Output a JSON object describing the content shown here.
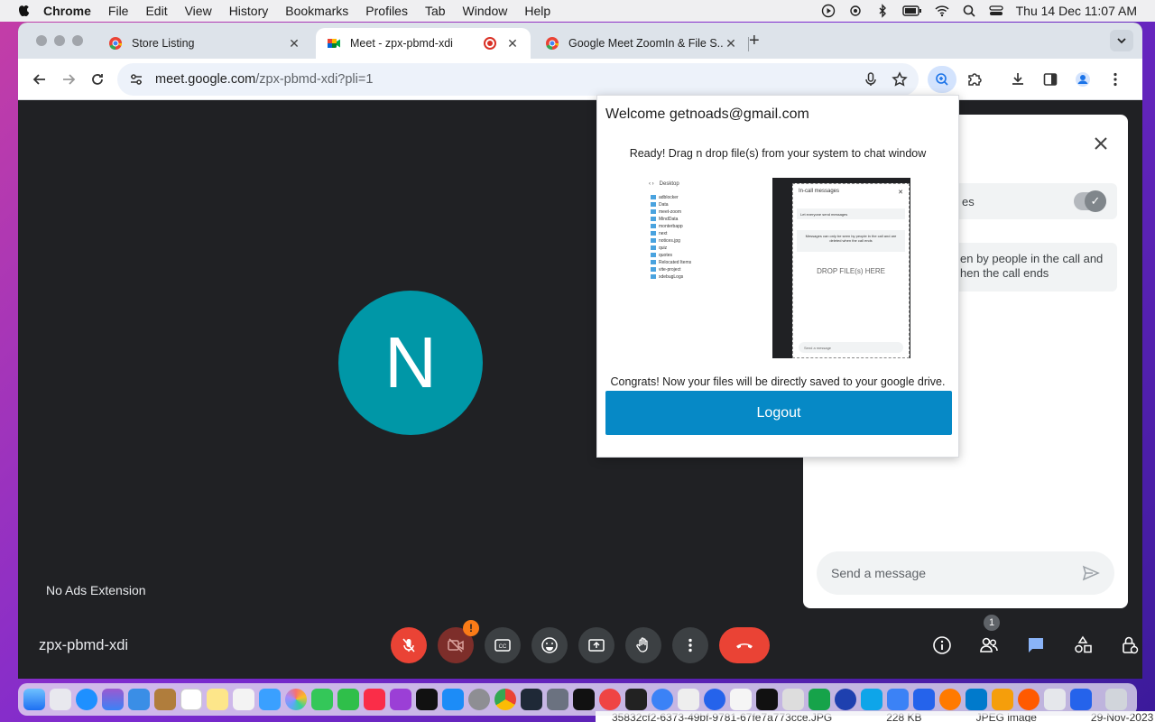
{
  "menubar": {
    "app_name": "Chrome",
    "items": [
      "File",
      "Edit",
      "View",
      "History",
      "Bookmarks",
      "Profiles",
      "Tab",
      "Window",
      "Help"
    ],
    "datetime": "Thu 14 Dec  11:07 AM"
  },
  "tabs": [
    {
      "title": "Store Listing",
      "active": false
    },
    {
      "title": "Meet - zpx-pbmd-xdi",
      "active": true,
      "recording": true
    },
    {
      "title": "Google Meet ZoomIn & File S...",
      "active": false
    }
  ],
  "toolbar": {
    "url_host": "meet.google.com",
    "url_path": "/zpx-pbmd-xdi?pli=1"
  },
  "meet": {
    "avatar_initial": "N",
    "participant_name": "No Ads Extension",
    "meeting_code": "zpx-pbmd-xdi",
    "people_count": "1",
    "camera_warning": "!"
  },
  "chat_panel": {
    "toggle_label_partial": "es",
    "info_partial_line1": "en by people in the call and",
    "info_partial_line2": "hen the call ends",
    "input_placeholder": "Send a message"
  },
  "popup": {
    "welcome": "Welcome getnoads@gmail.com",
    "ready": "Ready! Drag n drop file(s) from your system to chat window",
    "congrats": "Congrats! Now your files will be directly saved to your google drive.",
    "logout_label": "Logout",
    "demo": {
      "finder_title": "Desktop",
      "finder_files": [
        "adblocker",
        "Data",
        "meet-zoom",
        "MindData",
        "monterbapp",
        "next",
        "notices.jpg",
        "quiz",
        "quotes",
        "Relocated Items",
        "vite-project",
        "xdebugLogs"
      ],
      "incall_title": "In-call messages",
      "incall_toggle": "Let everyone send messages",
      "incall_info": "Messages can only be seen by people in the call and are deleted when the call ends",
      "drop_text": "DROP FILE(s) HERE",
      "send_placeholder": "Send a message"
    }
  },
  "background_file": {
    "name": "35832cf2-6373-49bf-9781-67fe7a773cce.JPG",
    "size": "228 KB",
    "kind": "JPEG image",
    "date": "29-Nov-2023"
  },
  "colors": {
    "accent_blue": "#0689c6",
    "meet_teal": "#0097a7",
    "danger_red": "#ea4335"
  }
}
